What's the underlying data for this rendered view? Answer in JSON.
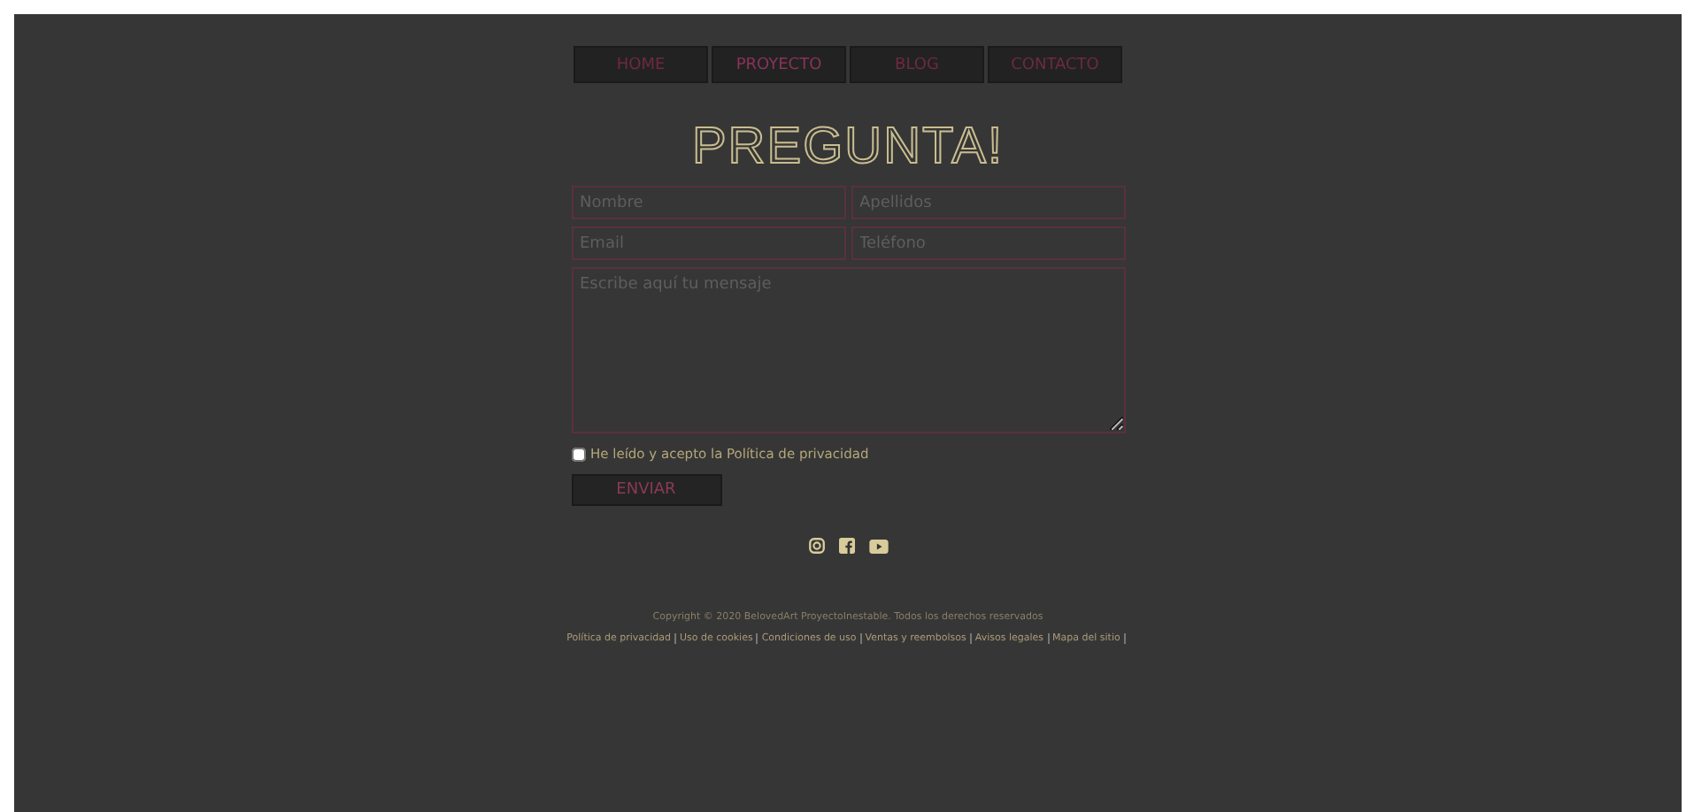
{
  "nav": [
    {
      "label": "HOME",
      "selected": false
    },
    {
      "label": "PROYECTO",
      "selected": true
    },
    {
      "label": "BLOG",
      "selected": false
    },
    {
      "label": "CONTACTO",
      "selected": false
    }
  ],
  "title": "PREGUNTA!",
  "form": {
    "fields": [
      {
        "placeholder": "Nombre"
      },
      {
        "placeholder": "Apellidos"
      },
      {
        "placeholder": "Email"
      },
      {
        "placeholder": "Teléfono"
      }
    ],
    "message": {
      "placeholder": "Escribe aquí tu mensaje"
    },
    "privacy": {
      "label": "He leído y acepto la Política de privacidad",
      "checked": false
    },
    "submit": "ENVIAR"
  },
  "social": [
    {
      "kind": "instagram"
    },
    {
      "kind": "facebook"
    },
    {
      "kind": "youtube"
    }
  ],
  "copyright": "Copyright © 2020 BelovedArt ProyectoInestable. Todos los derechos reservados",
  "legal_links": [
    "Política de privacidad",
    "Uso de cookies",
    "Condiciones de uso",
    "Ventas y reembolsos",
    "Avisos legales",
    "Mapa del sitio"
  ]
}
